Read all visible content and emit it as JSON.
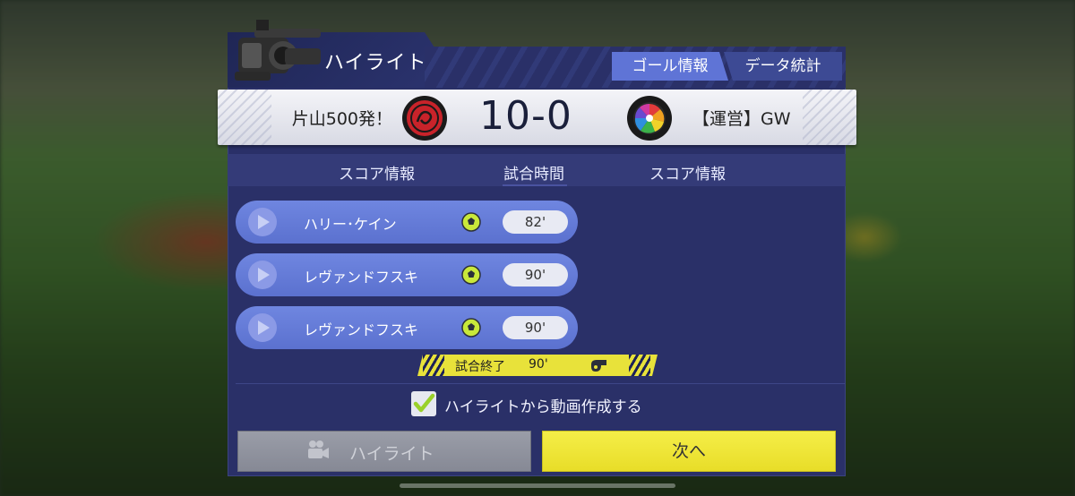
{
  "dialog": {
    "title": "ハイライト",
    "tabs": [
      {
        "label": "ゴール情報",
        "active": true
      },
      {
        "label": "データ統計",
        "active": false
      }
    ]
  },
  "match": {
    "home_team": "片山500発！",
    "away_team": "【運営】GW",
    "score": "10-0",
    "home_emblem": "red-dragon-emblem-icon",
    "away_emblem": "pinwheel-emblem-icon"
  },
  "table": {
    "headers": [
      "スコア情報",
      "試合時間",
      "スコア情報"
    ],
    "goals": [
      {
        "player": "ハリー･ケイン",
        "minute": "82'"
      },
      {
        "player": "レヴァンドフスキ",
        "minute": "90'"
      },
      {
        "player": "レヴァンドフスキ",
        "minute": "90'"
      }
    ]
  },
  "match_end": {
    "label": "試合終了",
    "minute": "90'"
  },
  "create_video": {
    "label": "ハイライトから動画作成する",
    "checked": true
  },
  "buttons": {
    "highlight": "ハイライト",
    "next": "次へ"
  },
  "colors": {
    "panel": "#2a3068",
    "tab_active": "#5f74d6",
    "goal_row": "#6f86e0",
    "accent_yellow": "#f5ee48",
    "check_green": "#9ad12a"
  }
}
